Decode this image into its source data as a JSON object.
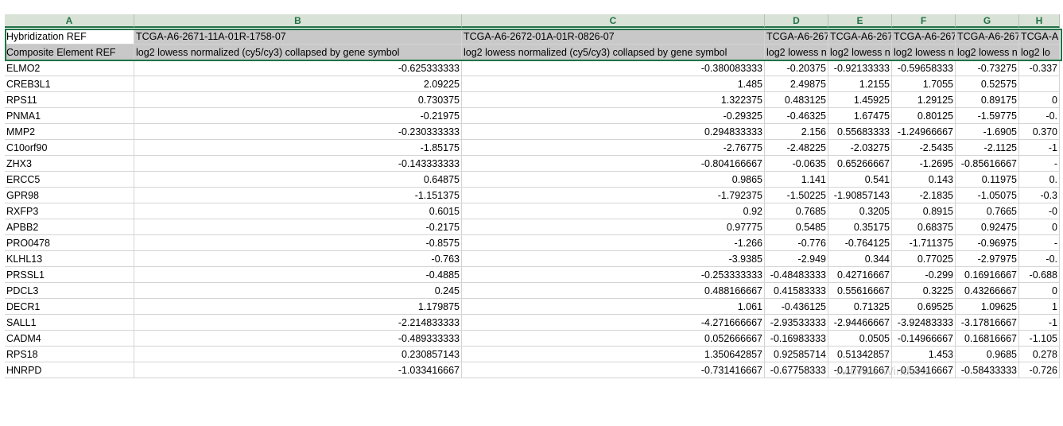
{
  "columns": [
    "A",
    "B",
    "C",
    "D",
    "E",
    "F",
    "G",
    "H"
  ],
  "header_row1": [
    "Hybridization REF",
    "TCGA-A6-2671-11A-01R-1758-07",
    "TCGA-A6-2672-01A-01R-0826-07",
    "TCGA-A6-267",
    "TCGA-A6-267",
    "TCGA-A6-267",
    "TCGA-A6-267",
    "TCGA-A"
  ],
  "header_row2": [
    "Composite Element REF",
    "log2 lowess normalized (cy5/cy3) collapsed by gene symbol",
    "log2 lowess normalized (cy5/cy3) collapsed by gene symbol",
    "log2 lowess n",
    "log2 lowess n",
    "log2 lowess n",
    "log2 lowess n",
    "log2 lo"
  ],
  "rows": [
    [
      "ELMO2",
      "-0.625333333",
      "-0.380083333",
      "-0.20375",
      "-0.92133333",
      "-0.59658333",
      "-0.73275",
      "-0.337"
    ],
    [
      "CREB3L1",
      "2.09225",
      "1.485",
      "2.49875",
      "1.2155",
      "1.7055",
      "0.52575",
      ""
    ],
    [
      "RPS11",
      "0.730375",
      "1.322375",
      "0.483125",
      "1.45925",
      "1.29125",
      "0.89175",
      "0"
    ],
    [
      "PNMA1",
      "-0.21975",
      "-0.29325",
      "-0.46325",
      "1.67475",
      "0.80125",
      "-1.59775",
      "-0."
    ],
    [
      "MMP2",
      "-0.230333333",
      "0.294833333",
      "2.156",
      "0.55683333",
      "-1.24966667",
      "-1.6905",
      "0.370"
    ],
    [
      "C10orf90",
      "-1.85175",
      "-2.76775",
      "-2.48225",
      "-2.03275",
      "-2.5435",
      "-2.1125",
      "-1"
    ],
    [
      "ZHX3",
      "-0.143333333",
      "-0.804166667",
      "-0.0635",
      "0.65266667",
      "-1.2695",
      "-0.85616667",
      "-"
    ],
    [
      "ERCC5",
      "0.64875",
      "0.9865",
      "1.141",
      "0.541",
      "0.143",
      "0.11975",
      "0."
    ],
    [
      "GPR98",
      "-1.151375",
      "-1.792375",
      "-1.50225",
      "-1.90857143",
      "-2.1835",
      "-1.05075",
      "-0.3"
    ],
    [
      "RXFP3",
      "0.6015",
      "0.92",
      "0.7685",
      "0.3205",
      "0.8915",
      "0.7665",
      "-0"
    ],
    [
      "APBB2",
      "-0.2175",
      "0.97775",
      "0.5485",
      "0.35175",
      "0.68375",
      "0.92475",
      "0"
    ],
    [
      "PRO0478",
      "-0.8575",
      "-1.266",
      "-0.776",
      "-0.764125",
      "-1.711375",
      "-0.96975",
      "-"
    ],
    [
      "KLHL13",
      "-0.763",
      "-3.9385",
      "-2.949",
      "0.344",
      "0.77025",
      "-2.97975",
      "-0."
    ],
    [
      "PRSSL1",
      "-0.4885",
      "-0.253333333",
      "-0.48483333",
      "0.42716667",
      "-0.299",
      "0.16916667",
      "-0.688"
    ],
    [
      "PDCL3",
      "0.245",
      "0.488166667",
      "0.41583333",
      "0.55616667",
      "0.3225",
      "0.43266667",
      "0"
    ],
    [
      "DECR1",
      "1.179875",
      "1.061",
      "-0.436125",
      "0.71325",
      "0.69525",
      "1.09625",
      "1"
    ],
    [
      "SALL1",
      "-2.214833333",
      "-4.271666667",
      "-2.93533333",
      "-2.94466667",
      "-3.92483333",
      "-3.17816667",
      "-1"
    ],
    [
      "CADM4",
      "-0.489333333",
      "0.052666667",
      "-0.16983333",
      "0.0505",
      "-0.14966667",
      "0.16816667",
      "-1.105"
    ],
    [
      "RPS18",
      "0.230857143",
      "1.350642857",
      "0.92585714",
      "0.51342857",
      "1.453",
      "0.9685",
      "0.278"
    ],
    [
      "HNRPD",
      "-1.033416667",
      "-0.731416667",
      "-0.67758333",
      "-0.17791667",
      "-0.53416667",
      "-0.58433333",
      "-0.726"
    ]
  ],
  "watermark": "Activate Windows"
}
